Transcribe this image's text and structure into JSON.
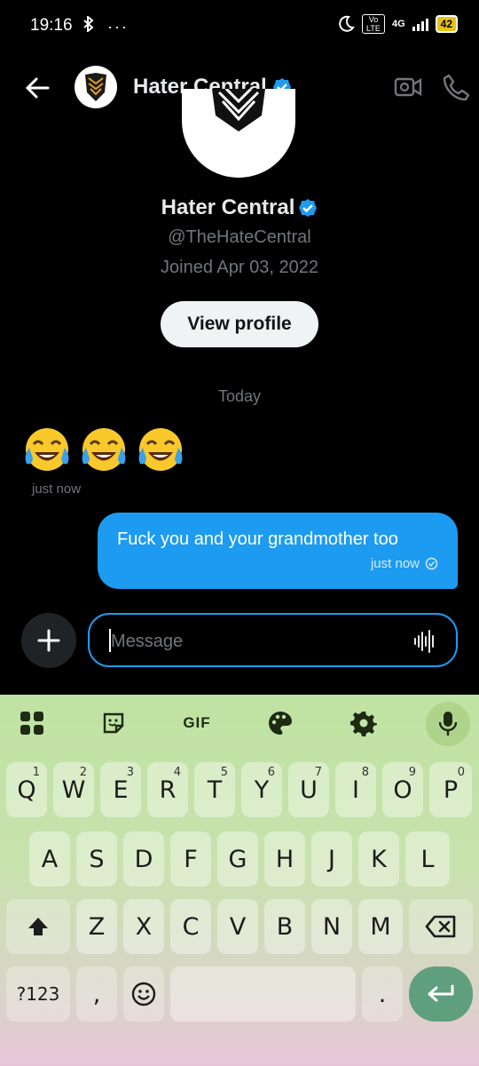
{
  "status_bar": {
    "time": "19:16",
    "left_icons": "⁰ ···",
    "battery": "42",
    "network": "4G",
    "volte": "Vo LTE"
  },
  "header": {
    "title": "Hater Central",
    "icons": [
      "back-arrow-icon",
      "verified-badge-icon",
      "video-call-icon",
      "phone-call-icon"
    ]
  },
  "profile": {
    "name": "Hater Central",
    "handle": "@TheHateCentral",
    "joined": "Joined Apr 03, 2022",
    "view_profile_label": "View profile"
  },
  "conversation": {
    "date_divider": "Today",
    "messages": [
      {
        "from": "other",
        "text": "😂😂😂",
        "time": "just now"
      },
      {
        "from": "me",
        "text": "Fuck you and your grandmother too",
        "time": "just now",
        "status": "sent"
      }
    ]
  },
  "composer": {
    "placeholder": "Message",
    "value": ""
  },
  "keyboard": {
    "toolbar": [
      "apps-grid-icon",
      "sticker-icon",
      "GIF",
      "palette-icon",
      "settings-icon",
      "mic-icon"
    ],
    "gif_label": "GIF",
    "row1": [
      {
        "k": "Q",
        "n": "1"
      },
      {
        "k": "W",
        "n": "2"
      },
      {
        "k": "E",
        "n": "3"
      },
      {
        "k": "R",
        "n": "4"
      },
      {
        "k": "T",
        "n": "5"
      },
      {
        "k": "Y",
        "n": "6"
      },
      {
        "k": "U",
        "n": "7"
      },
      {
        "k": "I",
        "n": "8"
      },
      {
        "k": "O",
        "n": "9"
      },
      {
        "k": "P",
        "n": "0"
      }
    ],
    "row2": [
      "A",
      "S",
      "D",
      "F",
      "G",
      "H",
      "J",
      "K",
      "L"
    ],
    "row3": [
      "Z",
      "X",
      "C",
      "V",
      "B",
      "N",
      "M"
    ],
    "sym_label": "?123",
    "comma": ",",
    "period": "."
  },
  "colors": {
    "accent": "#1d9bf0",
    "background": "#000000",
    "secondary_text": "#71767b"
  }
}
